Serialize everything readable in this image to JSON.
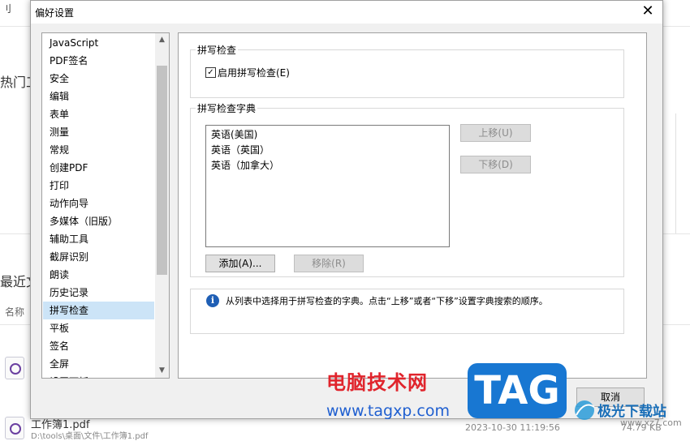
{
  "background": {
    "top_left": "刂",
    "hot_label": "热门工",
    "recent_label": "最近文",
    "name_header": "名称",
    "file_name": "工作簿1.pdf",
    "file_path": "D:\\tools\\桌面\\文件\\工作簿1.pdf",
    "file_time": "2023-10-30 11:19:56",
    "file_size": "74.79 KB"
  },
  "dialog": {
    "title": "偏好设置",
    "close_glyph": "✕",
    "categories": [
      "JavaScript",
      "PDF签名",
      "安全",
      "编辑",
      "表单",
      "测量",
      "常规",
      "创建PDF",
      "打印",
      "动作向导",
      "多媒体（旧版）",
      "辅助工具",
      "截屏识别",
      "朗读",
      "历史记录",
      "拼写检查",
      "平板",
      "签名",
      "全屏",
      "设置面板"
    ],
    "selected_category": "拼写检查",
    "spell_group_label": "拼写检查",
    "enable_check": {
      "label": "启用拼写检查(E)",
      "checked": true,
      "glyph": "✓"
    },
    "dict_group_label": "拼写检查字典",
    "dictionaries": [
      "英语(美国)",
      "英语（英国）",
      "英语（加拿大）"
    ],
    "buttons": {
      "move_up": "上移(U)",
      "move_down": "下移(D)",
      "add": "添加(A)...",
      "remove": "移除(R)",
      "cancel": "取消"
    },
    "info_text": "从列表中选择用于拼写检查的字典。点击“上移”或者“下移”设置字典搜索的顺序。",
    "info_glyph": "i"
  },
  "watermark": {
    "site_name": "电脑技术网",
    "site_url": "www.tagxp.com",
    "tag": "TAG",
    "logo_text": "极光下载站",
    "logo_url": "www.xz7.com"
  },
  "colors": {
    "selection": "#cce4f7",
    "info_icon": "#1f5fb5",
    "watermark_red": "#e0242c",
    "watermark_blue": "#1877d2"
  }
}
